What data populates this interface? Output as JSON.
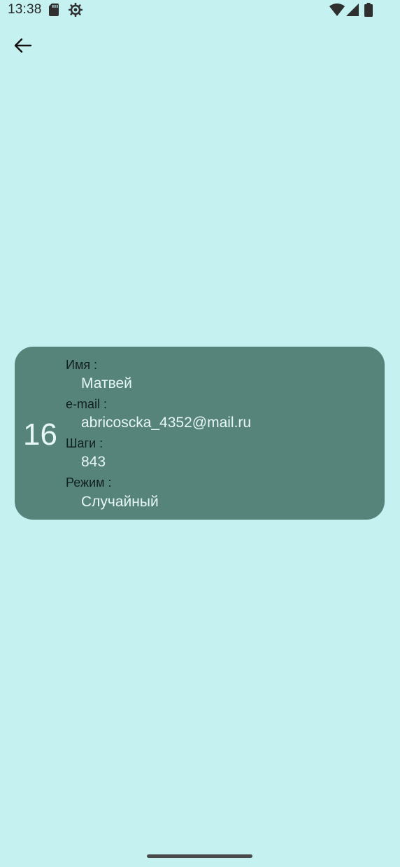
{
  "status_bar": {
    "time": "13:38",
    "icons": [
      "sd-card-icon",
      "settings-icon",
      "wifi-icon",
      "signal-icon",
      "battery-icon"
    ]
  },
  "navigation": {
    "back_icon": "arrow-back-icon"
  },
  "record": {
    "rank": "16",
    "name_label": "Имя :",
    "name_value": "Матвей",
    "email_label": "e-mail :",
    "email_value": "abricoscka_4352@mail.ru",
    "steps_label": "Шаги :",
    "steps_value": "843",
    "mode_label": "Режим :",
    "mode_value": "Случайный"
  },
  "colors": {
    "background": "#c5f1f1",
    "card": "#57847a",
    "card_text": "#e6f7f6",
    "label_text": "#102020"
  }
}
